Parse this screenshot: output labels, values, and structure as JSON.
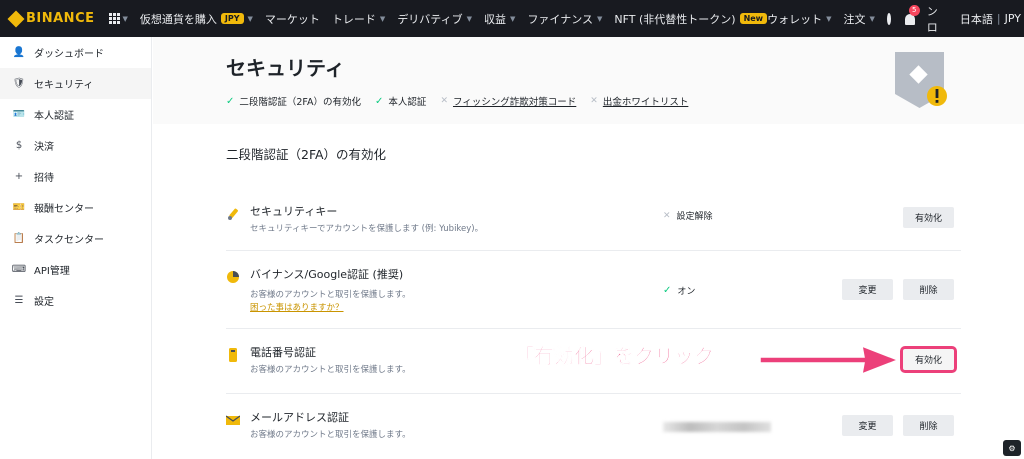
{
  "brand": {
    "name": "BINANCE",
    "accent": "#f0b90b"
  },
  "topnav": {
    "items": [
      {
        "label": "仮想通貨を購入",
        "pill": "JPY",
        "caret": true
      },
      {
        "label": "マーケット",
        "caret": false
      },
      {
        "label": "トレード",
        "caret": true
      },
      {
        "label": "デリバティブ",
        "caret": true
      },
      {
        "label": "収益",
        "caret": true
      },
      {
        "label": "ファイナンス",
        "caret": true
      },
      {
        "label": "NFT (非代替性トークン)",
        "pill": "New",
        "caret": false
      }
    ],
    "wallet": "ウォレット",
    "orders": "注文",
    "notifications": "5",
    "download": "ダウンロード",
    "language": "日本語",
    "separator": "|",
    "currency": "JPY"
  },
  "sidebar": {
    "items": [
      {
        "label": "ダッシュボード",
        "icon": "👤"
      },
      {
        "label": "セキュリティ",
        "icon": "🛡"
      },
      {
        "label": "本人認証",
        "icon": "🪪"
      },
      {
        "label": "決済",
        "icon": "$"
      },
      {
        "label": "招待",
        "icon": "+"
      },
      {
        "label": "報酬センター",
        "icon": "🎫"
      },
      {
        "label": "タスクセンター",
        "icon": "📋"
      },
      {
        "label": "API管理",
        "icon": "⌨"
      },
      {
        "label": "設定",
        "icon": "☰"
      }
    ]
  },
  "header": {
    "title": "セキュリティ",
    "statuses": [
      {
        "label": "二段階認証（2FA）の有効化",
        "state": "done"
      },
      {
        "label": "本人認証",
        "state": "done"
      },
      {
        "label": "フィッシング詐欺対策コード",
        "state": "todo"
      },
      {
        "label": "出金ホワイトリスト",
        "state": "todo"
      }
    ]
  },
  "section": {
    "title": "二段階認証（2FA）の有効化",
    "rows": [
      {
        "title": "セキュリティキー",
        "desc": "セキュリティキーでアカウントを保護します (例: Yubikey)。",
        "status_text": "設定解除",
        "status_kind": "off",
        "buttons": [
          "有効化"
        ]
      },
      {
        "title": "バイナンス/Google認証 (推奨)",
        "desc": "お客様のアカウントと取引を保護します。",
        "help": "困った事はありますか？",
        "status_text": "オン",
        "status_kind": "on",
        "buttons": [
          "変更",
          "削除"
        ]
      },
      {
        "title": "電話番号認証",
        "desc": "お客様のアカウントと取引を保護します。",
        "status_text": "",
        "status_kind": "hidden",
        "buttons": [
          "有効化"
        ]
      },
      {
        "title": "メールアドレス認証",
        "desc": "お客様のアカウントと取引を保護します。",
        "status_text": "",
        "status_kind": "blurred",
        "buttons": [
          "変更",
          "削除"
        ]
      }
    ]
  },
  "annotation": {
    "text": "「有効化」をクリック",
    "color": "#ec407a"
  },
  "colors": {
    "success": "#0ecb81",
    "topbar": "#181a20",
    "danger": "#f6465d"
  }
}
